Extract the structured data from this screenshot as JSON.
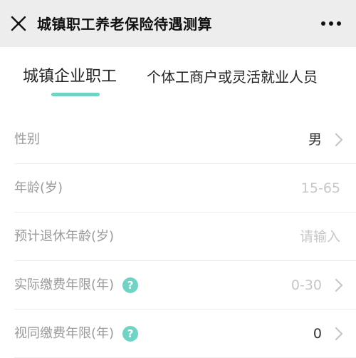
{
  "header": {
    "title": "城镇职工养老保险待遇测算",
    "close_icon": "close-icon",
    "more_icon": "more-dots-icon"
  },
  "tabs": [
    {
      "label": "城镇企业职工",
      "active": true
    },
    {
      "label": "个体工商户或灵活就业人员",
      "active": false
    }
  ],
  "accent_color": "#6fd4c4",
  "form": {
    "rows": [
      {
        "label": "性别",
        "value": "男",
        "value_is_placeholder": false,
        "chevron": true,
        "help": false
      },
      {
        "label": "年龄(岁)",
        "value": "15-65",
        "value_is_placeholder": true,
        "chevron": false,
        "help": false
      },
      {
        "label": "预计退休年龄(岁)",
        "value": "请输入",
        "value_is_placeholder": true,
        "chevron": false,
        "help": false
      },
      {
        "label": "实际缴费年限(年)",
        "value": "0-30",
        "value_is_placeholder": true,
        "chevron": true,
        "help": true
      },
      {
        "label": "视同缴费年限(年)",
        "value": "0",
        "value_is_placeholder": false,
        "chevron": true,
        "help": true
      }
    ],
    "help_glyph": "?"
  }
}
